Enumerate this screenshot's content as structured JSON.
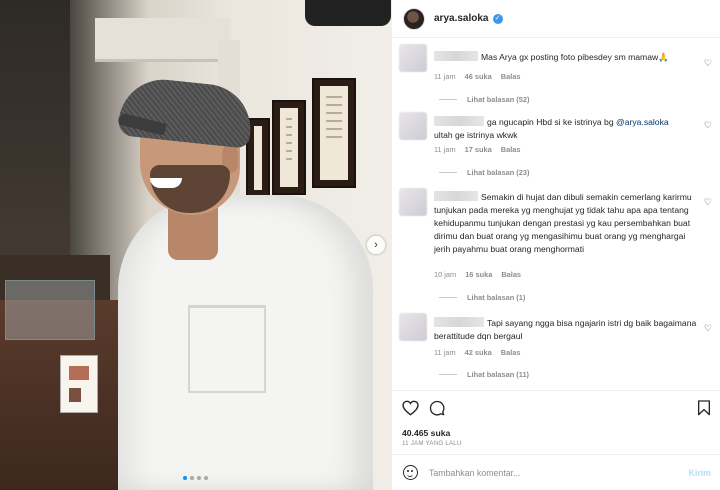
{
  "post": {
    "username": "arya.saloka",
    "verified_mark": "✓",
    "likes": "40.465 suka",
    "posted": "11 JAM YANG LALU",
    "carousel": {
      "slides": 4,
      "active_index": 0,
      "next_symbol": "›"
    }
  },
  "comments": [
    {
      "text": "Mas Arya gx posting foto pibesdey sm mamaw🙏",
      "time": "11 jam",
      "likes": "46 suka",
      "reply": "Balas",
      "view_replies": "Lihat balasan (52)"
    },
    {
      "text_before": "ga ngucapin Hbd si ke istrinya bg ",
      "mention": "@arya.saloka",
      "text_after": "ultah ge istrinya wkwk",
      "time": "11 jam",
      "likes": "17 suka",
      "reply": "Balas",
      "view_replies": "Lihat balasan (23)"
    },
    {
      "text": "Semakin di hujat dan dibuli semakin cemerlang karirmu tunjukan pada mereka yg menghujat yg tidak tahu apa apa tentang kehidupanmu tunjukan dengan prestasi yg kau persembahkan buat dirimu dan buat orang yg mengasihimu buat orang yg menghargai jerih payahmu buat orang menghormati",
      "time": "10 jam",
      "likes": "16 suka",
      "reply": "Balas",
      "view_replies": "Lihat balasan (1)"
    },
    {
      "text": "Tapi sayang ngga bisa ngajarin istri dg baik bagaimana berattitude dqn bergaul",
      "time": "11 jam",
      "likes": "42 suka",
      "reply": "Balas",
      "view_replies": "Lihat balasan (11)"
    }
  ],
  "icons": {
    "heart": "♡",
    "comment": "◯",
    "bookmark": "⊓"
  },
  "composer": {
    "placeholder": "Tambahkan komentar...",
    "send_label": "Kirim"
  },
  "colors": {
    "link": "#00376b",
    "send_disabled": "#b2dffc",
    "verified": "#3897f0",
    "muted": "#8e8e8e"
  }
}
